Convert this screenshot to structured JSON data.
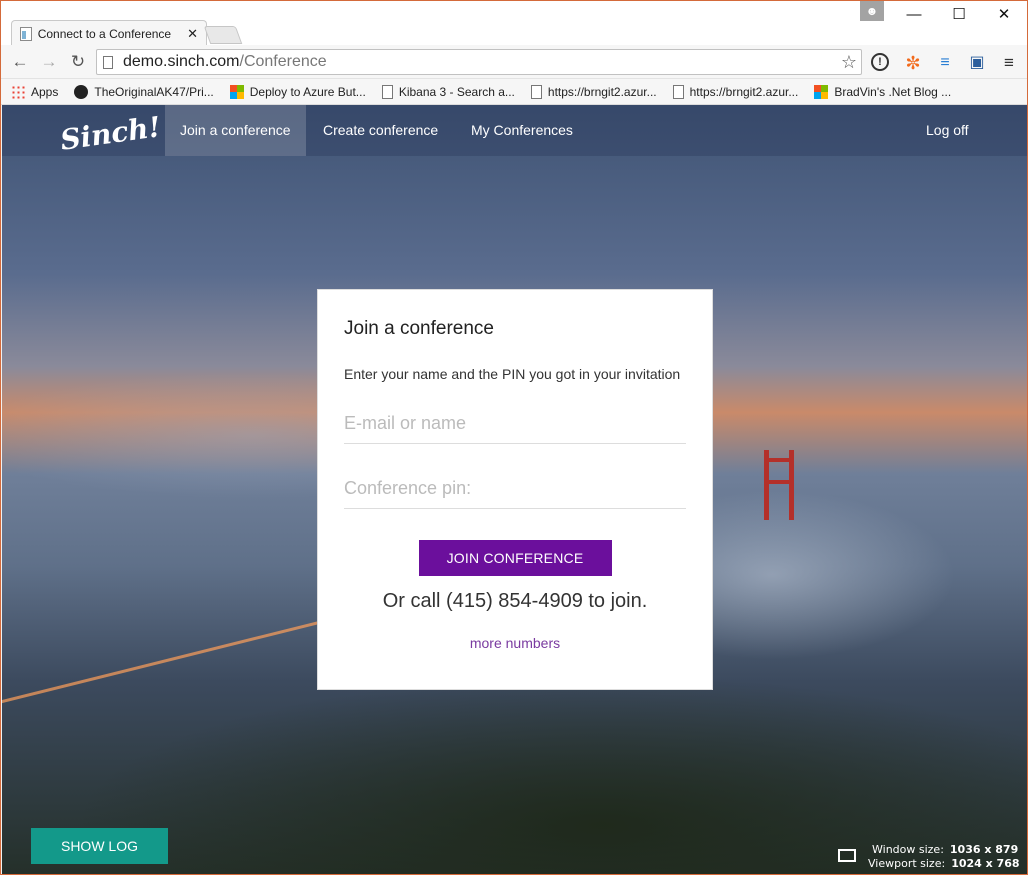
{
  "browser": {
    "tab_title": "Connect to a Conference",
    "tab_close": "✕",
    "profile_icon": "person-icon",
    "minimize": "—",
    "maximize": "☐",
    "close": "✕",
    "url_host": "demo.sinch.com",
    "url_path": "/Conference",
    "bookmarks": [
      {
        "label": "Apps",
        "icon": "apps-icon"
      },
      {
        "label": "TheOriginalAK47/Pri...",
        "icon": "github-icon"
      },
      {
        "label": "Deploy to Azure But...",
        "icon": "microsoft-icon"
      },
      {
        "label": "Kibana 3 - Search a...",
        "icon": "page-icon"
      },
      {
        "label": "https://brngit2.azur...",
        "icon": "page-icon"
      },
      {
        "label": "https://brngit2.azur...",
        "icon": "page-icon"
      },
      {
        "label": "BradVin's .Net Blog ...",
        "icon": "microsoft-icon"
      }
    ]
  },
  "site": {
    "logo": "Sinch!",
    "nav": {
      "join": "Join a conference",
      "create": "Create conference",
      "mine": "My Conferences",
      "logoff": "Log off"
    },
    "card": {
      "title": "Join a conference",
      "instructions": "Enter your name and the PIN you got in your invitation",
      "name_placeholder": "E-mail or name",
      "pin_placeholder": "Conference pin:",
      "join_label": "JOIN CONFERENCE",
      "call_text": "Or call (415) 854-4909 to join.",
      "more_link": "more numbers"
    },
    "show_log": "SHOW LOG"
  },
  "size_overlay": {
    "window_label": "Window size:",
    "window_value": "1036 x 879",
    "viewport_label": "Viewport size:",
    "viewport_value": "1024 x 768"
  },
  "colors": {
    "join_button": "#6b0f9c",
    "show_log_button": "#13998a",
    "link": "#7a3ba0"
  }
}
